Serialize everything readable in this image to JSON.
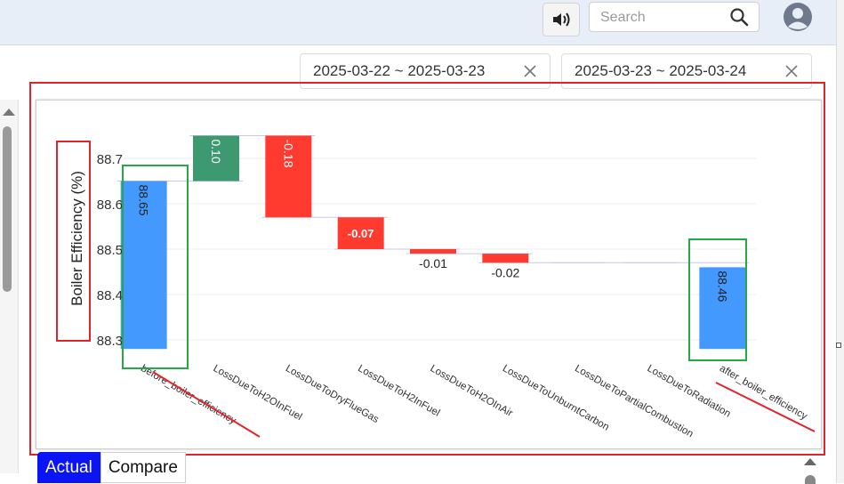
{
  "header": {
    "search_placeholder": "Search",
    "icons": {
      "sound": "speaker-icon",
      "search": "search-icon",
      "user": "user-avatar-icon"
    }
  },
  "date_filters": [
    {
      "label": "2025-03-22 ~ 2025-03-23"
    },
    {
      "label": "2025-03-23 ~ 2025-03-24"
    }
  ],
  "tabs": [
    {
      "label": "Actual",
      "active": true
    },
    {
      "label": "Compare",
      "active": false
    }
  ],
  "colors": {
    "increase": "#3d9970",
    "decrease": "#ff3b30",
    "total": "#4499ff",
    "annotation_red": "#e0242c",
    "annotation_green": "#27a844",
    "tab_active": "#0a14f5"
  },
  "chart_data": {
    "type": "waterfall",
    "ylabel": "Boiler Efficiency (%)",
    "ylim": [
      88.26,
      88.78
    ],
    "yticks": [
      "88.3",
      "88.4",
      "88.5",
      "88.6",
      "88.7"
    ],
    "categories": [
      "before_boiler_efficiency",
      "LossDueToH2OInFuel",
      "LossDueToDryFlueGas",
      "LossDueToH2InFuel",
      "LossDueToH2OInAir",
      "LossDueToUnburntCarbon",
      "LossDueToPartialCombustion",
      "LossDueToRadiation",
      "after_boiler_efficiency"
    ],
    "measures": [
      "absolute",
      "relative",
      "relative",
      "relative",
      "relative",
      "relative",
      "relative",
      "relative",
      "total"
    ],
    "values": [
      88.65,
      0.1,
      -0.18,
      -0.07,
      -0.01,
      -0.02,
      0,
      0,
      88.46
    ],
    "text_labels": [
      "88.65",
      "0.10",
      "-0.18",
      "-0.07",
      "-0.01",
      "-0.02",
      "",
      "",
      "88.46"
    ],
    "base": 88.28,
    "grid": true
  }
}
